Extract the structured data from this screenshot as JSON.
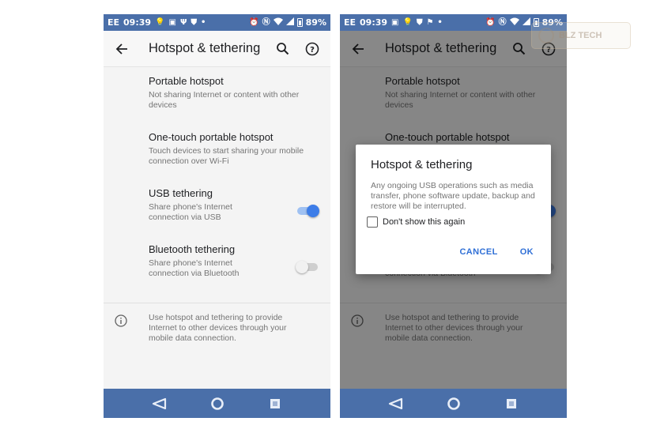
{
  "colors": {
    "status_bar": "#4a6fa9",
    "nav_bar": "#4a6fa9",
    "accent": "#3d7de8",
    "dialog_button": "#2f6fd6"
  },
  "status_bar": {
    "carrier": "EE",
    "time": "09:39",
    "battery": "89%",
    "left_icons_left": [
      "bulb-icon",
      "photo-icon",
      "usb-icon",
      "shield-icon",
      "dot-icon"
    ],
    "left_icons_right": [
      "photo-icon",
      "bulb-icon",
      "shield-icon",
      "flag-icon",
      "dot-icon"
    ],
    "right_icons": [
      "alarm-icon",
      "nfc-icon",
      "wifi-icon",
      "signal-icon",
      "battery-icon"
    ]
  },
  "app_bar": {
    "title": "Hotspot & tethering",
    "back_icon": "arrow-left-icon",
    "search_icon": "search-icon",
    "help_icon": "help-circle-icon"
  },
  "settings": [
    {
      "title": "Portable hotspot",
      "summary": "Not sharing Internet or content with other devices",
      "has_switch": false
    },
    {
      "title": "One-touch portable hotspot",
      "summary": "Touch devices to start sharing your mobile connection over Wi-Fi",
      "has_switch": false
    },
    {
      "title": "USB tethering",
      "summary": "Share phone's Internet connection via USB",
      "has_switch": true,
      "switch_on": true
    },
    {
      "title": "Bluetooth tethering",
      "summary": "Share phone's Internet connection via Bluetooth",
      "has_switch": true,
      "switch_on": false
    }
  ],
  "info": {
    "icon": "info-icon",
    "text": "Use hotspot and tethering to provide Internet to other devices through your mobile data connection."
  },
  "nav_bar": {
    "back": "nav-back-icon",
    "home": "nav-home-icon",
    "recents": "nav-recents-icon"
  },
  "dialog": {
    "title": "Hotspot & tethering",
    "message": "Any ongoing USB operations such as media transfer, phone software update, backup and restore will be interrupted.",
    "checkbox_label": "Don't show this again",
    "checkbox_checked": false,
    "cancel_label": "CANCEL",
    "ok_label": "OK"
  },
  "watermark": {
    "text": "BLZ TECH"
  }
}
